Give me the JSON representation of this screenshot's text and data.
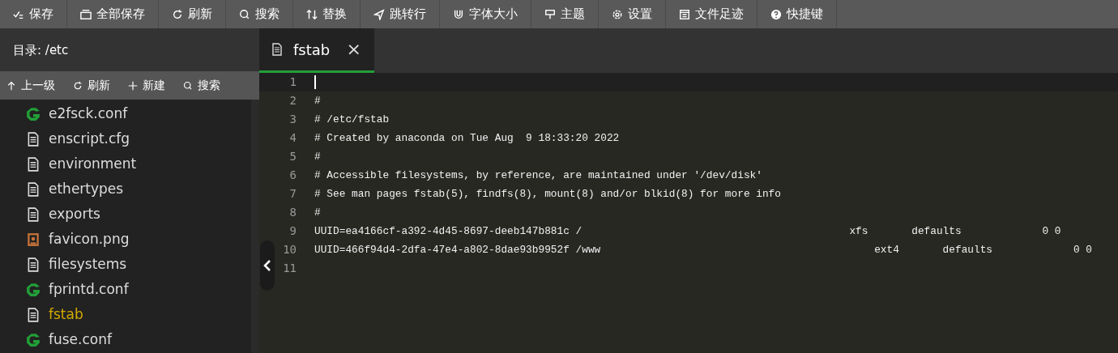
{
  "toolbar": [
    {
      "kind": "save",
      "label": "保存"
    },
    {
      "kind": "save-all",
      "label": "全部保存"
    },
    {
      "kind": "refresh",
      "label": "刷新"
    },
    {
      "kind": "search",
      "label": "搜索"
    },
    {
      "kind": "replace",
      "label": "替换"
    },
    {
      "kind": "goto",
      "label": "跳转行"
    },
    {
      "kind": "font",
      "label": "字体大小"
    },
    {
      "kind": "theme",
      "label": "主题"
    },
    {
      "kind": "settings",
      "label": "设置"
    },
    {
      "kind": "history",
      "label": "文件足迹"
    },
    {
      "kind": "help",
      "label": "快捷键"
    }
  ],
  "sidebar": {
    "directory": "目录: /etc",
    "actions": [
      {
        "kind": "up",
        "label": "上一级"
      },
      {
        "kind": "refresh",
        "label": "刷新"
      },
      {
        "kind": "new",
        "label": "新建"
      },
      {
        "kind": "search",
        "label": "搜索"
      }
    ],
    "files": [
      {
        "kind": "config",
        "name": "e2fsck.conf",
        "selected": false
      },
      {
        "kind": "text",
        "name": "enscript.cfg",
        "selected": false
      },
      {
        "kind": "text",
        "name": "environment",
        "selected": false
      },
      {
        "kind": "text",
        "name": "ethertypes",
        "selected": false
      },
      {
        "kind": "text",
        "name": "exports",
        "selected": false
      },
      {
        "kind": "image",
        "name": "favicon.png",
        "selected": false
      },
      {
        "kind": "text",
        "name": "filesystems",
        "selected": false
      },
      {
        "kind": "config",
        "name": "fprintd.conf",
        "selected": false
      },
      {
        "kind": "text",
        "name": "fstab",
        "selected": true
      },
      {
        "kind": "config",
        "name": "fuse.conf",
        "selected": false
      }
    ]
  },
  "tabs": [
    {
      "label": "fstab",
      "selected": true,
      "close": "×"
    }
  ],
  "editor": {
    "lines": [
      {
        "number": "1",
        "current": true
      },
      {
        "number": "2",
        "text": "#",
        "current": false
      },
      {
        "number": "3",
        "text": "# /etc/fstab",
        "current": false
      },
      {
        "number": "4",
        "text": "# Created by anaconda on Tue Aug  9 18:33:20 2022",
        "current": false
      },
      {
        "number": "5",
        "text": "#",
        "current": false
      },
      {
        "number": "6",
        "text": "# Accessible filesystems, by reference, are maintained under '/dev/disk'",
        "current": false
      },
      {
        "number": "7",
        "text": "# See man pages fstab(5), findfs(8), mount(8) and/or blkid(8) for more info",
        "current": false
      },
      {
        "number": "8",
        "text": "#",
        "current": false
      },
      {
        "number": "9",
        "text": "UUID=ea4166cf-a392-4d45-8697-deeb147b881c /                                           xfs       defaults             0 0",
        "current": false
      },
      {
        "number": "10",
        "text": "UUID=466f94d4-2dfa-47e4-a802-8dae93b9952f /www                                            ext4       defaults             0 0",
        "current": false
      },
      {
        "number": "11",
        "current": false
      }
    ]
  }
}
